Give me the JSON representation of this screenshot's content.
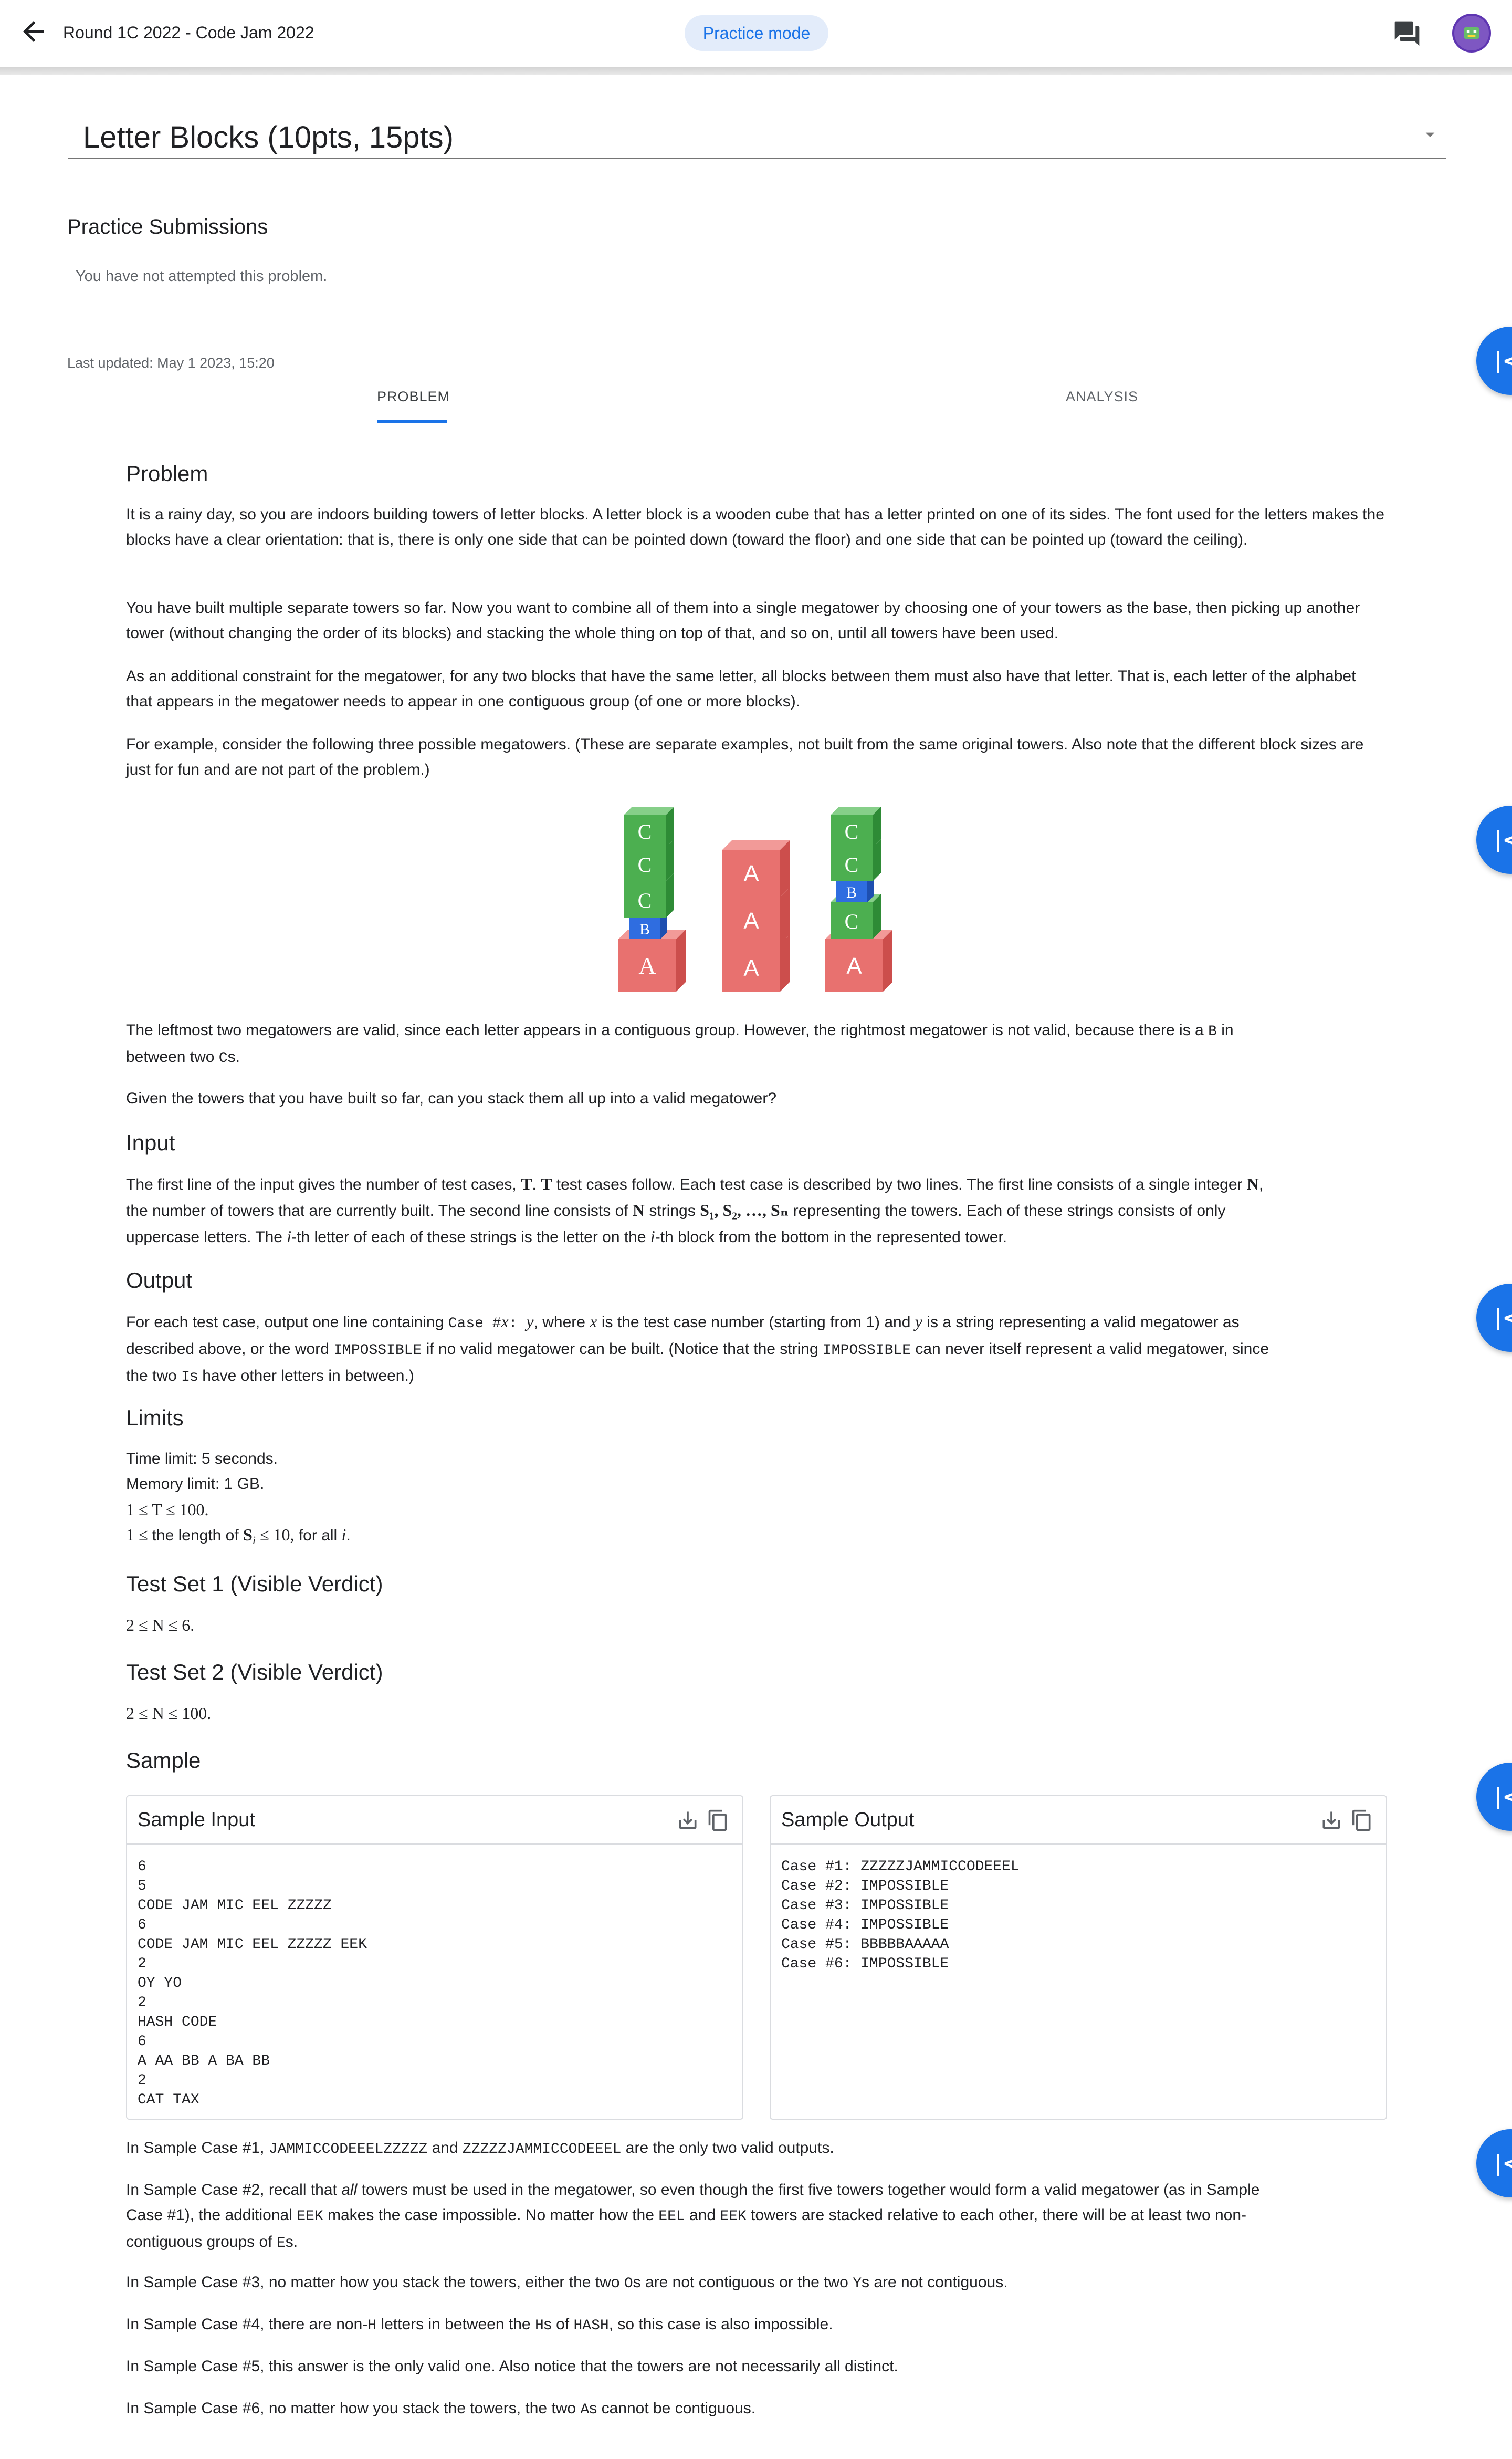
{
  "header": {
    "title": "Round 1C 2022 - Code Jam 2022",
    "mode_chip": "Practice mode"
  },
  "problem_selector": {
    "value": "Letter Blocks (10pts, 15pts)"
  },
  "submissions": {
    "heading": "Practice Submissions",
    "empty_text": "You have not attempted this problem."
  },
  "last_updated": "Last updated: May 1 2023, 15:20",
  "tabs": [
    {
      "label": "PROBLEM",
      "selected": true
    },
    {
      "label": "ANALYSIS",
      "selected": false
    }
  ],
  "side_button_glyph": "|<",
  "colors": {
    "accent": "#1a73e8",
    "block_red": "#e06666",
    "block_green": "#4caf50",
    "block_blue": "#2f6de0"
  },
  "statement": {
    "problem_heading": "Problem",
    "p1": "It is a rainy day, so you are indoors building towers of letter blocks. A letter block is a wooden cube that has a letter printed on one of its sides. The font used for the letters makes the blocks have a clear orientation: that is, there is only one side that can be pointed down (toward the floor) and one side that can be pointed up (toward the ceiling).",
    "p2": "You have built multiple separate towers so far. Now you want to combine all of them into a single megatower by choosing one of your towers as the base, then picking up another tower (without changing the order of its blocks) and stacking the whole thing on top of that, and so on, until all towers have been used.",
    "p3": "As an additional constraint for the megatower, for any two blocks that have the same letter, all blocks between them must also have that letter. That is, each letter of the alphabet that appears in the megatower needs to appear in one contiguous group (of one or more blocks).",
    "p4": "For example, consider the following three possible megatowers. (These are separate examples, not built from the same original towers. Also note that the different block sizes are just for fun and are not part of the problem.)",
    "figure_towers": [
      [
        "A",
        "B",
        "C",
        "C",
        "C"
      ],
      [
        "A",
        "A",
        "A"
      ],
      [
        "A",
        "C",
        "B",
        "C",
        "C"
      ]
    ],
    "p5a": "The leftmost two megatowers are valid, since each letter appears in a contiguous group. However, the rightmost megatower is not valid, because there is a ",
    "p5b": "B",
    "p5c": " in",
    "p5d": "between two ",
    "p5e": "C",
    "p5f": "s.",
    "p6": "Given the towers that you have built so far, can you stack them all up into a valid megatower?",
    "input_heading": "Input",
    "input_l1a": "The first line of the input gives the number of test cases, ",
    "input_T": "T",
    "input_l1b": ". ",
    "input_l1c": " test cases follow. Each test case is described by two lines. The first line consists of a single integer ",
    "input_N": "N",
    "input_l1d": ",",
    "input_l2a": "the number of towers that are currently built. The second line consists of ",
    "input_l2b": " strings ",
    "input_strings": "S₁, S₂, …, Sₙ",
    "input_l2c": " representing the towers. Each of these strings consists of only",
    "input_l3a": "uppercase letters. The ",
    "input_i": "i",
    "input_l3b": "-th letter of each of these strings is the letter on the ",
    "input_l3c": "-th block from the bottom in the represented tower.",
    "output_heading": "Output",
    "output_l1a": "For each test case, output one line containing ",
    "output_case": "Case #",
    "output_x": "x",
    "output_colon": ": ",
    "output_y": "y",
    "output_l1b": ", where ",
    "output_l1c": " is the test case number (starting from 1) and ",
    "output_l1d": " is a string representing a valid megatower as",
    "output_l2a": "described above, or the word ",
    "output_impossible": "IMPOSSIBLE",
    "output_l2b": " if no valid megatower can be built. (Notice that the string ",
    "output_l2c": " can never itself represent a valid megatower, since",
    "output_l3a": "the two ",
    "output_I": "I",
    "output_l3b": "s have other letters in between.)",
    "limits_heading": "Limits",
    "limits": [
      "Time limit: 5 seconds.",
      "Memory limit: 1 GB."
    ],
    "limit_T": "1 ≤ T ≤ 100.",
    "limit_len_a": "1 ≤ ",
    "limit_len_b": "the length of ",
    "limit_len_c": "S",
    "limit_len_d": "i",
    "limit_len_e": " ≤ 10,",
    "limit_len_f": " for all ",
    "limit_len_g": "i",
    "limit_len_h": ".",
    "ts1_heading": "Test Set 1 (Visible Verdict)",
    "ts1_limit": "2 ≤ N ≤ 6.",
    "ts2_heading": "Test Set 2 (Visible Verdict)",
    "ts2_limit": "2 ≤ N ≤ 100.",
    "sample_heading": "Sample"
  },
  "sample": {
    "input_title": "Sample Input",
    "output_title": "Sample Output",
    "input_text": "6\n5\nCODE JAM MIC EEL ZZZZZ\n6\nCODE JAM MIC EEL ZZZZZ EEK\n2\nOY YO\n2\nHASH CODE\n6\nA AA BB A BA BB\n2\nCAT TAX",
    "output_text": "Case #1: ZZZZZJAMMICCODEEEL\nCase #2: IMPOSSIBLE\nCase #3: IMPOSSIBLE\nCase #4: IMPOSSIBLE\nCase #5: BBBBBAAAAA\nCase #6: IMPOSSIBLE"
  },
  "explanations": {
    "e1a": "In Sample Case #1, ",
    "e1b": "JAMMICCODEEELZZZZZ",
    "e1c": " and ",
    "e1d": "ZZZZZJAMMICCODEEEL",
    "e1e": " are the only two valid outputs.",
    "e2a": "In Sample Case #2, recall that ",
    "e2b": "all",
    "e2c": " towers must be used in the megatower, so even though the first five towers together would form a valid megatower (as in Sample",
    "e2d": "Case #1), the additional ",
    "e2e": "EEK",
    "e2f": " makes the case impossible. No matter how the ",
    "e2g": "EEL",
    "e2h": " and ",
    "e2i": "EEK",
    "e2j": " towers are stacked relative to each other, there will be at least two non-",
    "e2k": "contiguous groups of ",
    "e2l": "E",
    "e2m": "s.",
    "e3a": "In Sample Case #3, no matter how you stack the towers, either the two ",
    "e3b": "O",
    "e3c": "s are not contiguous or the two ",
    "e3d": "Y",
    "e3e": "s are not contiguous.",
    "e4a": "In Sample Case #4, there are non-",
    "e4b": "H",
    "e4c": " letters in between the ",
    "e4d": "H",
    "e4e": "s of ",
    "e4f": "HASH",
    "e4g": ", so this case is also impossible.",
    "e5": "In Sample Case #5, this answer is the only valid one. Also notice that the towers are not necessarily all distinct.",
    "e6a": "In Sample Case #6, no matter how you stack the towers, the two ",
    "e6b": "A",
    "e6c": "s cannot be contiguous."
  }
}
